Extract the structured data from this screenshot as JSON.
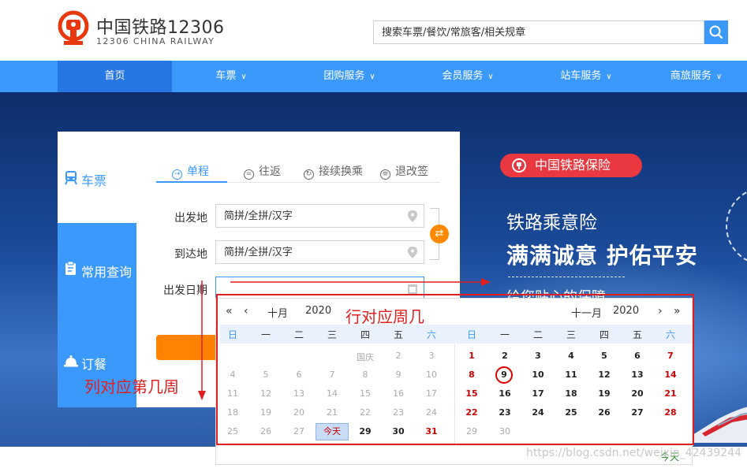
{
  "header": {
    "title": "中国铁路12306",
    "subtitle": "12306 CHINA RAILWAY",
    "search_placeholder": "搜索车票/餐饮/常旅客/相关规章"
  },
  "nav": [
    {
      "label": "首页",
      "active": true,
      "dropdown": false
    },
    {
      "label": "车票",
      "dropdown": true
    },
    {
      "label": "团购服务",
      "dropdown": true
    },
    {
      "label": "会员服务",
      "dropdown": true
    },
    {
      "label": "站车服务",
      "dropdown": true
    },
    {
      "label": "商旅服务",
      "dropdown": true
    }
  ],
  "hero": {
    "badge": "中国铁路保险",
    "line1": "铁路乘意险",
    "line2": "满满诚意 护佑平安",
    "line3": "给您贴心的保障"
  },
  "sidebar": [
    {
      "label": "车票",
      "icon": "train-icon",
      "active": true
    },
    {
      "label": "常用查询",
      "icon": "clipboard-icon"
    },
    {
      "label": "订餐",
      "icon": "food-bell-icon"
    }
  ],
  "tabs": [
    {
      "label": "单程",
      "icon": "arrow-right-icon",
      "active": true
    },
    {
      "label": "往返",
      "icon": "roundtrip-icon"
    },
    {
      "label": "接续换乘",
      "icon": "transfer-icon"
    },
    {
      "label": "退改签",
      "icon": "refund-icon"
    }
  ],
  "form": {
    "from_label": "出发地",
    "from_placeholder": "简拼/全拼/汉字",
    "to_label": "到达地",
    "to_placeholder": "简拼/全拼/汉字",
    "date_label": "出发日期",
    "date_value": ""
  },
  "calendar": {
    "left_month": "十月",
    "left_year": "2020",
    "right_month": "十一月",
    "right_year": "2020",
    "weekdays": [
      "日",
      "一",
      "二",
      "三",
      "四",
      "五",
      "六"
    ],
    "today_label": "今天",
    "footer_today": "今天",
    "left_days": [
      [
        "",
        "",
        "",
        "",
        "国庆",
        "2",
        "3"
      ],
      [
        "4",
        "5",
        "6",
        "7",
        "8",
        "9",
        "10"
      ],
      [
        "11",
        "12",
        "13",
        "14",
        "15",
        "16",
        "17"
      ],
      [
        "18",
        "19",
        "20",
        "21",
        "22",
        "23",
        "24"
      ],
      [
        "25",
        "26",
        "27",
        "今天",
        "29",
        "30",
        "31"
      ]
    ],
    "right_days": [
      [
        "1",
        "2",
        "3",
        "4",
        "5",
        "6",
        "7"
      ],
      [
        "8",
        "9",
        "10",
        "11",
        "12",
        "13",
        "14"
      ],
      [
        "15",
        "16",
        "17",
        "18",
        "19",
        "20",
        "21"
      ],
      [
        "22",
        "23",
        "24",
        "25",
        "26",
        "27",
        "28"
      ],
      [
        "29",
        "30",
        "",
        "",
        "",
        "",
        ""
      ]
    ]
  },
  "annotations": {
    "row_note": "行对应周几",
    "col_note": "列对应第几周"
  },
  "watermark": "https://blog.csdn.net/weixin_42439244",
  "colors": {
    "brand_blue": "#3b99fc",
    "nav_active": "#2676e3",
    "logo_red": "#e8380d",
    "insurance_red": "#e9383f",
    "swap_orange": "#ff8a00",
    "annotation_red": "#e02020",
    "holiday_red": "#cc0000"
  }
}
